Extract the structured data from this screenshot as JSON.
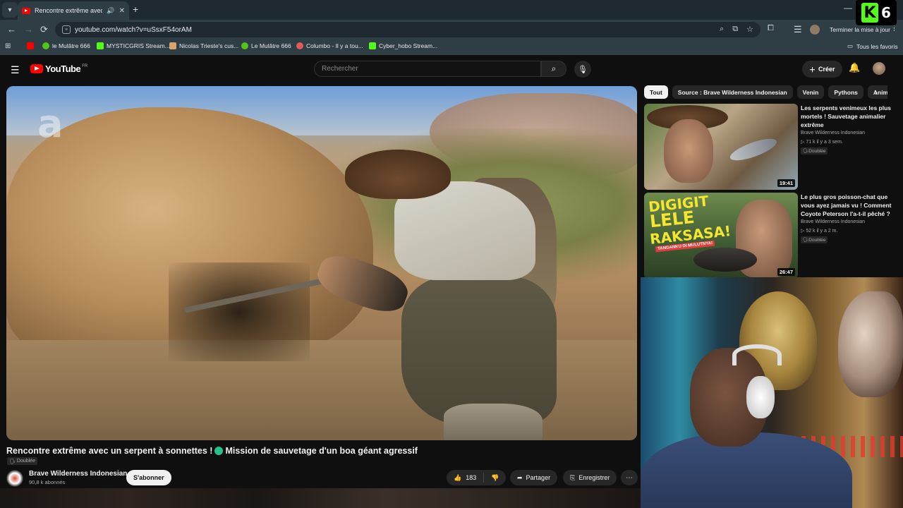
{
  "browser": {
    "tab": {
      "title": "Rencontre extrême avec un serpent à sonnettes"
    },
    "url": "youtube.com/watch?v=uSsxF54orAM",
    "update_button": "Terminer la mise à jour",
    "bookmarks": [
      {
        "label": "",
        "color": "#ff0000"
      },
      {
        "label": "le Mulâtre 666",
        "color": "#53c41a"
      },
      {
        "label": "MYSTICGRIS Stream...",
        "color": "#53fc18"
      },
      {
        "label": "Nicolas Trieste's cus...",
        "color": "#d9a46b"
      },
      {
        "label": "Le Mulâtre 666",
        "color": "#53c41a"
      },
      {
        "label": "Columbo - Il y a tou...",
        "color": "#e05a5a"
      },
      {
        "label": "Cyber_hobo Stream...",
        "color": "#53fc18"
      }
    ],
    "all_favorites": "Tous les favoris"
  },
  "overlay": {
    "k_letter": "K",
    "number": "6"
  },
  "youtube": {
    "logo_text": "YouTube",
    "region": "FR",
    "search_placeholder": "Rechercher",
    "create_label": "Créer"
  },
  "video": {
    "watermark": "a",
    "title_part1": "Rencontre extrême avec un serpent à sonnettes !",
    "title_part2": "Mission de sauvetage d'un boa géant agressif",
    "dubbed_badge": "Doublée",
    "channel_name": "Brave Wilderness Indonesian",
    "subscribers": "90,8 k abonnés",
    "subscribe_label": "S'abonner",
    "like_count": "183",
    "share_label": "Partager",
    "save_label": "Enregistrer"
  },
  "chips": [
    "Tout",
    "Source : Brave Wilderness Indonesian",
    "Venin",
    "Pythons",
    "Animaux"
  ],
  "recommendations": [
    {
      "title": "Les serpents venimeux les plus mortels ! Sauvetage animalier extrême",
      "channel": "Brave Wilderness Indonesian",
      "meta": "71 k  il y a 3 sem.",
      "badge": "Doublée",
      "duration": "19:41"
    },
    {
      "title": "Le plus gros poisson-chat que vous ayez jamais vu ! Comment Coyote Peterson l'a-t-il pêché ?",
      "channel": "Brave Wilderness Indonesian",
      "meta": "52 k  il y a 2 m.",
      "badge": "Doublée",
      "duration": "26:47",
      "thumb_text": [
        "DIGIGIT",
        "LELE",
        "RAKSASA!"
      ],
      "thumb_tag": "TANGANKU DI MULUTNYA!"
    }
  ]
}
